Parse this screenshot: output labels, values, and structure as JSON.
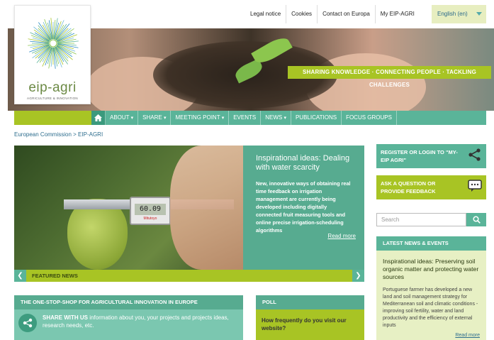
{
  "toplinks": [
    "Legal notice",
    "Cookies",
    "Contact on Europa",
    "My EIP-AGRI"
  ],
  "language": "English (en)",
  "logo": {
    "name": "eip-agri",
    "subtitle": "AGRICULTURE & INNOVATION"
  },
  "tagline": "SHARING KNOWLEDGE · CONNECTING PEOPLE · TACKLING CHALLENGES",
  "nav": {
    "home_icon": "home-icon",
    "items": [
      "ABOUT",
      "SHARE",
      "MEETING POINT",
      "EVENTS",
      "NEWS",
      "PUBLICATIONS",
      "FOCUS GROUPS"
    ],
    "caret": "▾"
  },
  "breadcrumb": "European Commission > EIP-AGRI",
  "featured": {
    "title": "Inspirational ideas: Dealing with water scarcity",
    "text": "New, innovative ways of obtaining real time feedback on irrigation management are currently being developed including digitally connected fruit measuring tools and online precise irrigation-scheduling algorithms",
    "read_more": "Read more",
    "label": "FEATURED NEWS",
    "caliper_reading": "60.09",
    "caliper_brand": "Mitutoyo"
  },
  "onestop": {
    "title": "THE ONE-STOP-SHOP FOR AGRICULTURAL INNOVATION IN EUROPE",
    "bold": "SHARE WITH US",
    "text": " information about you, your projects and projects ideas, research needs, etc."
  },
  "poll": {
    "title": "POLL",
    "question": "How frequently do you visit our website?"
  },
  "sidebar": {
    "register": "REGISTER OR LOGIN TO \"MY-EIP AGRI\"",
    "ask": "ASK A QUESTION OR PROVIDE FEEDBACK",
    "search_placeholder": "Search"
  },
  "latest": {
    "title": "LATEST NEWS & EVENTS",
    "headline": "Inspirational ideas: Preserving soil organic matter and protecting water sources",
    "text": "Portuguese farmer has developed a new land and soil management strategy for Mediterranean soil and climatic conditions - improving soil fertility, water and land productivity and the efficiency of external inputs",
    "read_more": "Read more"
  },
  "colors": {
    "green": "#5ab499",
    "lime": "#a8c424",
    "dark_green": "#3b9a7d"
  }
}
